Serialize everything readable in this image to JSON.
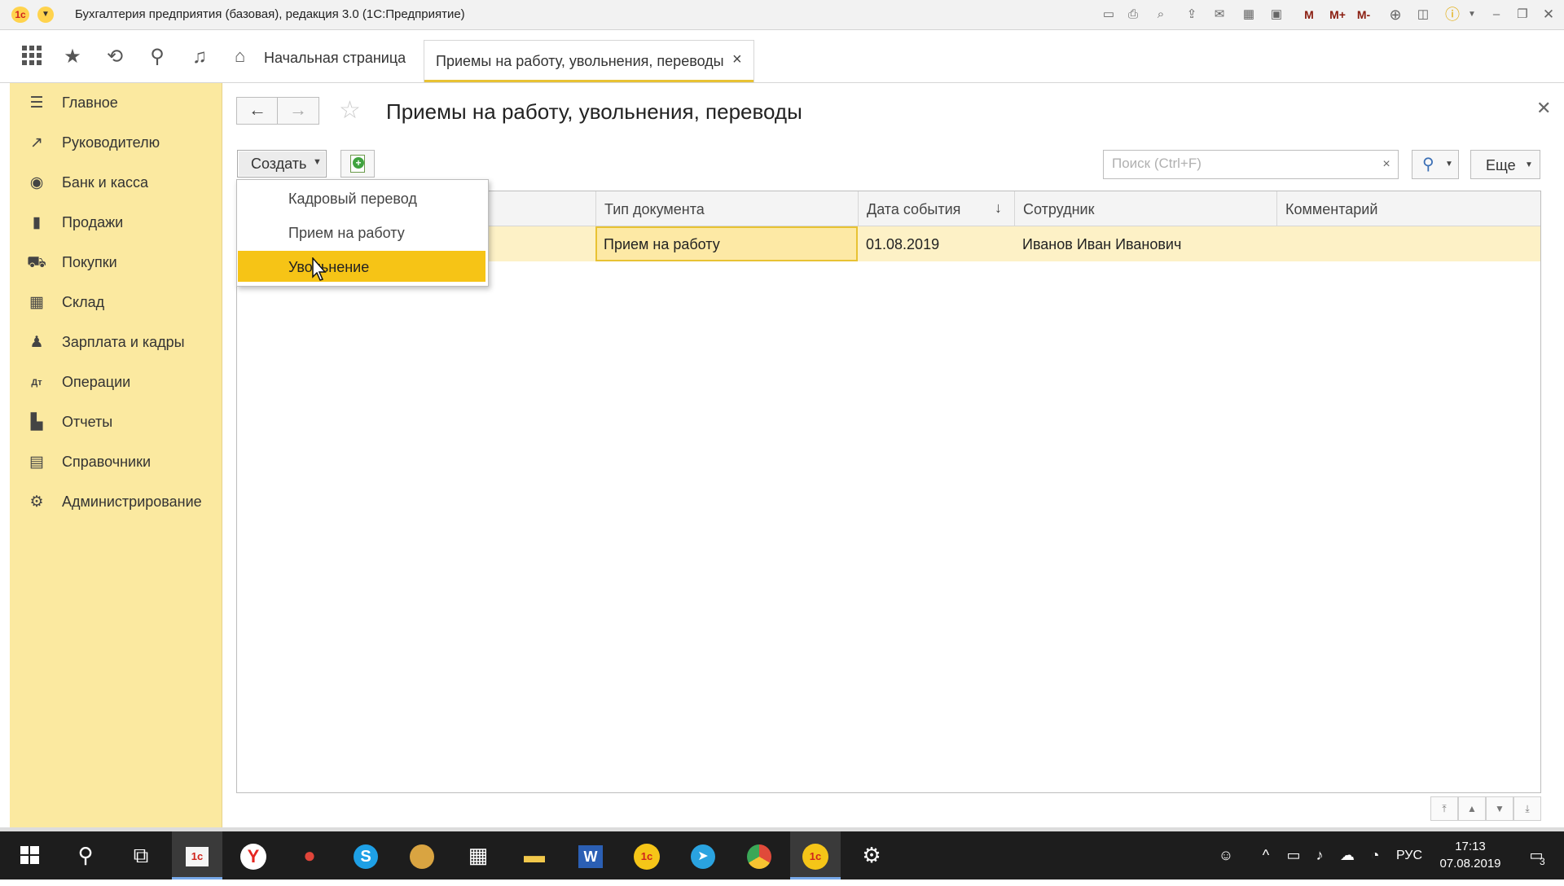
{
  "app": {
    "logo_text": "1с",
    "window_title": "Бухгалтерия предприятия (базовая), редакция 3.0  (1С:Предприятие)",
    "toolbar_icons": [
      "save-icon",
      "print-icon",
      "preview-icon",
      "upload-icon",
      "mail-icon",
      "table-icon",
      "calendar-icon",
      "m-icon",
      "m-plus-icon",
      "m-minus-icon",
      "zoom-icon",
      "panel-icon",
      "info-icon",
      "minimize-icon",
      "restore-icon",
      "close-icon"
    ],
    "m_labels": {
      "m": "M",
      "mplus": "M+",
      "mminus": "M-"
    }
  },
  "tabs": {
    "home_label": "Начальная страница",
    "active_label": "Приемы на работу, увольнения, переводы"
  },
  "sidebar": {
    "items": [
      {
        "label": "Главное",
        "icon": "menu-icon"
      },
      {
        "label": "Руководителю",
        "icon": "trend-icon"
      },
      {
        "label": "Банк и касса",
        "icon": "coin-icon"
      },
      {
        "label": "Продажи",
        "icon": "bag-icon"
      },
      {
        "label": "Покупки",
        "icon": "cart-icon"
      },
      {
        "label": "Склад",
        "icon": "warehouse-icon"
      },
      {
        "label": "Зарплата и кадры",
        "icon": "person-icon"
      },
      {
        "label": "Операции",
        "icon": "dt-kt-icon"
      },
      {
        "label": "Отчеты",
        "icon": "bar-chart-icon"
      },
      {
        "label": "Справочники",
        "icon": "books-icon"
      },
      {
        "label": "Администрирование",
        "icon": "gear-icon"
      }
    ]
  },
  "form": {
    "title": "Приемы на работу, увольнения, переводы",
    "create_label": "Создать",
    "search_placeholder": "Поиск (Ctrl+F)",
    "more_label": "Еще"
  },
  "table": {
    "columns": [
      "Тип документа",
      "Дата события",
      "Сотрудник",
      "Комментарий"
    ],
    "sorted_column": "Дата события",
    "rows": [
      {
        "type": "Прием на работу",
        "date": "01.08.2019",
        "employee": "Иванов Иван Иванович",
        "comment": ""
      }
    ]
  },
  "create_menu": {
    "items": [
      "Кадровый перевод",
      "Прием на работу",
      "Увольнение"
    ],
    "highlighted": "Увольнение"
  },
  "taskbar": {
    "apps": [
      "start-icon",
      "search-icon",
      "task-view-icon",
      "1c-start-icon",
      "yandex-browser-icon",
      "apple-icon",
      "skype-icon",
      "clock-app-icon",
      "calculator-icon",
      "file-explorer-icon",
      "word-icon",
      "1c-app-icon",
      "telegram-icon",
      "chrome-icon",
      "1c-active-icon",
      "settings-icon"
    ],
    "language": "РУС",
    "time": "17:13",
    "date": "07.08.2019",
    "notification_count": "3"
  },
  "colors": {
    "sidebar_bg": "#fbe9a0",
    "accent_yellow": "#f6c416",
    "row_highlight": "#fdf1c6",
    "taskbar_bg": "#1d1d1d"
  }
}
